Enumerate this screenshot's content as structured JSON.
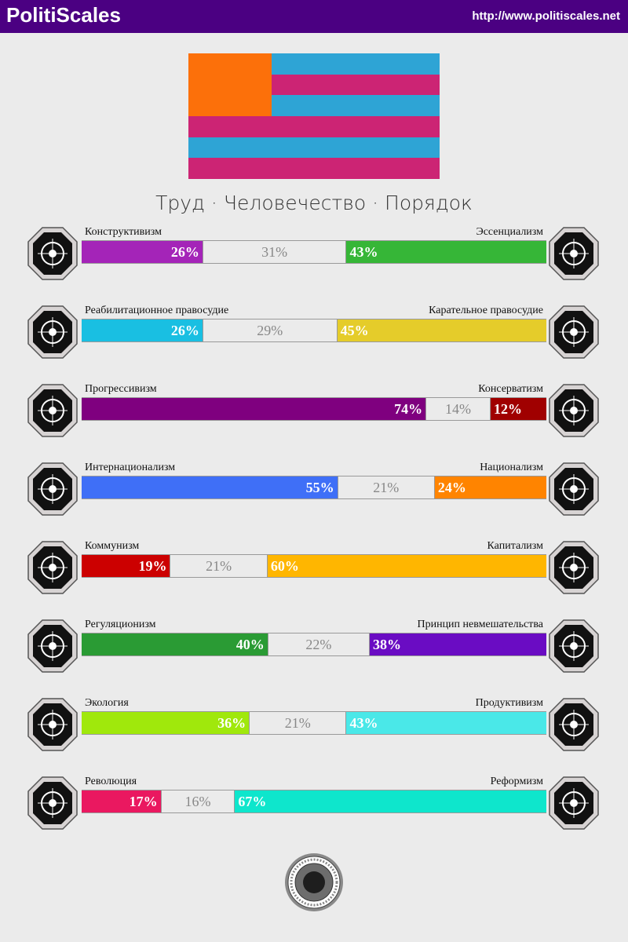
{
  "header": {
    "brand": "PolitiScales",
    "url": "http://www.politiscales.net",
    "background": "#4b0082"
  },
  "flag": {
    "stripes": [
      "#2ea4d5",
      "#cc2474",
      "#2ea4d5",
      "#cc2474",
      "#2ea4d5",
      "#cc2474"
    ],
    "canton": "#fc700a"
  },
  "ideology": "Труд · Человечество · Порядок",
  "axes": [
    {
      "left_label": "Конструктивизм",
      "right_label": "Эссенциализм",
      "left_value": 26,
      "mid_value": 31,
      "right_value": 43,
      "left_text": "26%",
      "mid_text": "31%",
      "right_text": "43%",
      "left_color": "#a424b8",
      "right_color": "#36b637",
      "left_icon": "eye-icon",
      "right_icon": "flower-icon"
    },
    {
      "left_label": "Реабилитационное правосудие",
      "right_label": "Карательное правосудие",
      "left_value": 26,
      "mid_value": 29,
      "right_value": 45,
      "left_text": "26%",
      "mid_text": "29%",
      "right_text": "45%",
      "left_color": "#19bfe2",
      "right_color": "#e5cc2a",
      "left_icon": "handshake-icon",
      "right_icon": "prison-bars-icon"
    },
    {
      "left_label": "Прогрессивизм",
      "right_label": "Консерватизм",
      "left_value": 74,
      "mid_value": 14,
      "right_value": 12,
      "left_text": "74%",
      "mid_text": "14%",
      "right_text": "12%",
      "left_color": "#7f007f",
      "right_color": "#a00000",
      "left_icon": "rocket-icon",
      "right_icon": "quill-icon"
    },
    {
      "left_label": "Интернационализм",
      "right_label": "Национализм",
      "left_value": 55,
      "mid_value": 21,
      "right_value": 24,
      "left_text": "55%",
      "mid_text": "21%",
      "right_text": "24%",
      "left_color": "#3f6ff7",
      "right_color": "#ff8400",
      "left_icon": "globe-icon",
      "right_icon": "flag-icon"
    },
    {
      "left_label": "Коммунизм",
      "right_label": "Капитализм",
      "left_value": 19,
      "mid_value": 21,
      "right_value": 60,
      "left_text": "19%",
      "mid_text": "21%",
      "right_text": "60%",
      "left_color": "#cc0000",
      "right_color": "#ffb600",
      "left_icon": "hammer-sickle-icon",
      "right_icon": "money-bag-icon"
    },
    {
      "left_label": "Регуляционизм",
      "right_label": "Принцип невмешательства",
      "left_value": 40,
      "mid_value": 22,
      "right_value": 38,
      "left_text": "40%",
      "mid_text": "22%",
      "right_text": "38%",
      "left_color": "#2a9b34",
      "right_color": "#6a0cc3",
      "left_icon": "ruler-icon",
      "right_icon": "butterfly-icon"
    },
    {
      "left_label": "Экология",
      "right_label": "Продуктивизм",
      "left_value": 36,
      "mid_value": 21,
      "right_value": 43,
      "left_text": "36%",
      "mid_text": "21%",
      "right_text": "43%",
      "left_color": "#a0e80c",
      "right_color": "#4ae8e8",
      "left_icon": "sprout-icon",
      "right_icon": "gear-icon"
    },
    {
      "left_label": "Революция",
      "right_label": "Реформизм",
      "left_value": 17,
      "mid_value": 16,
      "right_value": 67,
      "left_text": "17%",
      "mid_text": "16%",
      "right_text": "67%",
      "left_color": "#ea1860",
      "right_color": "#0ee6cc",
      "left_icon": "fist-icon",
      "right_icon": "ballot-box-icon"
    }
  ],
  "seal_icon": "seal-icon"
}
